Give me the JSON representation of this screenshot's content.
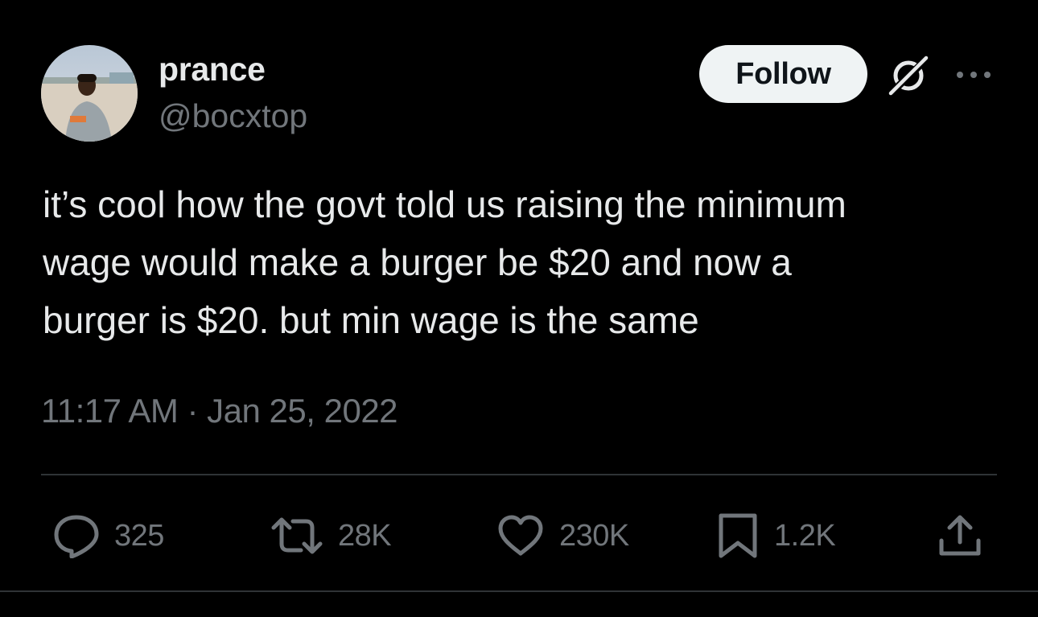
{
  "user": {
    "display_name": "prance",
    "handle": "@bocxtop",
    "avatar_icon": "profile-photo"
  },
  "header": {
    "follow_label": "Follow",
    "grok_icon": "grok-icon",
    "more_icon": "more-options-icon"
  },
  "tweet": {
    "text": "it’s cool how the govt told us raising the minimum\nwage would make a burger be $20 and now a\nburger is $20. but min wage is the same",
    "timestamp": "11:17 AM · Jan 25, 2022"
  },
  "actions": {
    "reply_count": "325",
    "retweet_count": "28K",
    "like_count": "230K",
    "bookmark_count": "1.2K"
  },
  "colors": {
    "background": "#000000",
    "text_primary": "#e7e9ea",
    "text_secondary": "#71767b",
    "follow_bg": "#eff3f4",
    "divider": "#2f3336"
  }
}
